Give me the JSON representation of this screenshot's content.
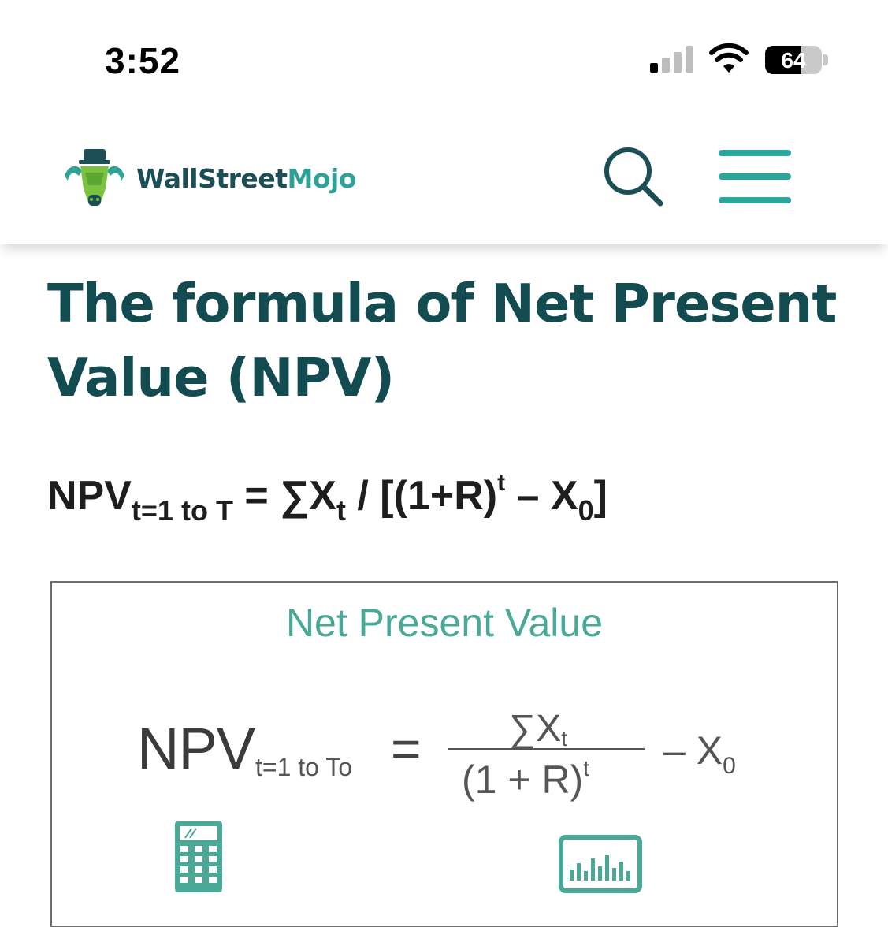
{
  "status_bar": {
    "time": "3:52",
    "battery": "64",
    "battery_level": 0.64,
    "signal_bars_active": 1,
    "signal_bars_total": 4
  },
  "header": {
    "logo": {
      "text_part1": "WallStreet",
      "text_part2": "Mojo",
      "icon": "bull-logo-icon"
    },
    "search_icon": "search-icon",
    "menu_icon": "hamburger-menu-icon"
  },
  "article": {
    "title": "The formula of Net Present Value (NPV)",
    "formula": {
      "lhs": "NPV",
      "lhs_sub": "t=1 to T",
      "equals_sum": "= ∑X",
      "sum_sub": "t",
      "divide": " / [(1+R)",
      "power": "t",
      "minus": " – X",
      "x0_sub": "0",
      "close": "]"
    }
  },
  "figure": {
    "title": "Net Present Value",
    "npv": "NPV",
    "npv_sub": "t=1 to To",
    "equals": "=",
    "numerator": "∑X",
    "numerator_sub": "t",
    "denominator": "(1 + R)",
    "denominator_sup": "t",
    "minus_term": "– X",
    "minus_term_sub": "0",
    "icons": [
      "calculator-icon",
      "bar-chart-icon"
    ]
  },
  "colors": {
    "brand_dark": "#124b50",
    "brand_teal": "#2aa69c",
    "figure_teal": "#4aa996"
  }
}
